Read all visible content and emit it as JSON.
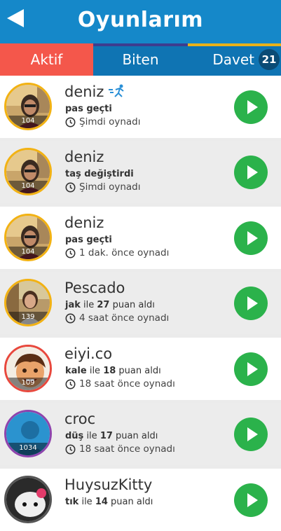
{
  "header": {
    "title": "Oyunlarım",
    "back_icon": "back-arrow-icon"
  },
  "tabs": [
    {
      "label": "Aktif"
    },
    {
      "label": "Biten"
    },
    {
      "label": "Davet",
      "badge": "21"
    }
  ],
  "colors": {
    "header": "#1588c9",
    "tabs": "#0f74b3",
    "active_tab": "#f4574b",
    "play": "#2bb24b",
    "gold_ring": "#f2b213"
  },
  "games": [
    {
      "name": "deniz",
      "action_word": "",
      "action_rest": "pas geçti",
      "time": "Şimdi oynadı",
      "score": "104",
      "avatar": "photo-man",
      "ring": "#f2b213",
      "runner": true
    },
    {
      "name": "deniz",
      "action_word": "",
      "action_rest": "taş değiştirdi",
      "time": "Şimdi oynadı",
      "score": "104",
      "avatar": "photo-man",
      "ring": "#f2b213",
      "runner": false
    },
    {
      "name": "deniz",
      "action_word": "",
      "action_rest": "pas geçti",
      "time": "1 dak. önce oynadı",
      "score": "104",
      "avatar": "photo-man",
      "ring": "#f2b213",
      "runner": false
    },
    {
      "name": "Pescado",
      "action_word": "jak",
      "action_mid": " ile ",
      "action_pts": "27",
      "action_end": " puan aldı",
      "time": "4 saat önce oynadı",
      "score": "139",
      "avatar": "photo-woman",
      "ring": "#f2b213",
      "runner": false
    },
    {
      "name": "eiyi.co",
      "action_word": "kale",
      "action_mid": " ile ",
      "action_pts": "18",
      "action_end": " puan aldı",
      "time": "18 saat önce oynadı",
      "score": "109",
      "avatar": "cartoon-boy",
      "ring": "#e8483d",
      "runner": false
    },
    {
      "name": "croc",
      "action_word": "düş",
      "action_mid": " ile ",
      "action_pts": "17",
      "action_end": " puan aldı",
      "time": "18 saat önce oynadı",
      "score": "1034",
      "avatar": "silhouette",
      "ring": "#8e44ad",
      "runner": false
    },
    {
      "name": "HuysuzKitty",
      "action_word": "tık",
      "action_mid": " ile ",
      "action_pts": "14",
      "action_end": " puan aldı",
      "time": "",
      "score": "",
      "avatar": "kitty",
      "ring": "#555555",
      "runner": false
    }
  ]
}
